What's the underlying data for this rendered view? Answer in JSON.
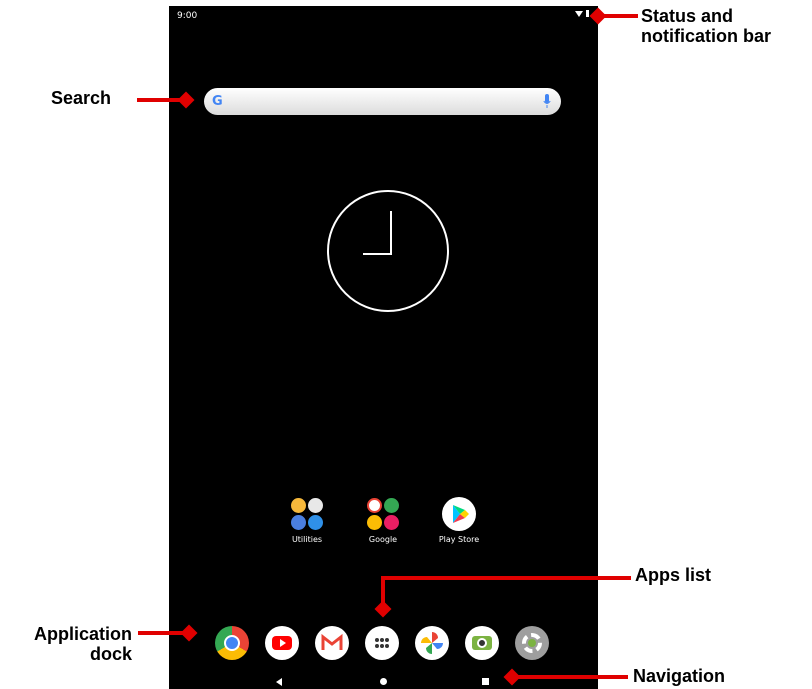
{
  "status_bar": {
    "time": "9:00"
  },
  "home": {
    "apps": [
      {
        "label": "Utilities"
      },
      {
        "label": "Google"
      },
      {
        "label": "Play Store"
      }
    ]
  },
  "callouts": {
    "status": "Status and notification bar",
    "status_line1": "Status and",
    "status_line2": "notification bar",
    "search": "Search",
    "apps_list": "Apps list",
    "dock_line1": "Application",
    "dock_line2": "dock",
    "navigation": "Navigation"
  },
  "dock": {
    "icons": [
      "chrome-icon",
      "youtube-icon",
      "gmail-icon",
      "apps-list-icon",
      "photos-icon",
      "camera-icon",
      "settings-icon"
    ]
  },
  "navigation_bar": {
    "buttons": [
      "back-icon",
      "home-icon",
      "recents-icon"
    ]
  },
  "colors": {
    "annotation": "#e00000",
    "screen": "#000000"
  }
}
